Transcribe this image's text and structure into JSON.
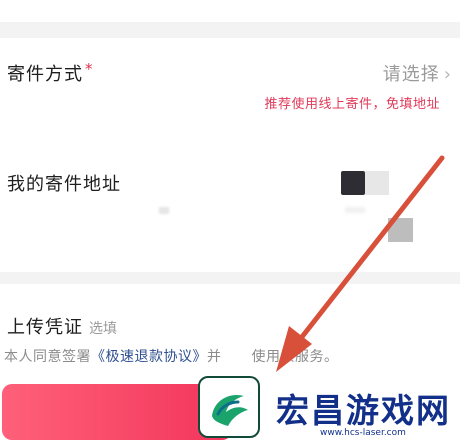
{
  "shipping": {
    "method_label": "寄件方式",
    "required_mark": "*",
    "select_placeholder": "请选择",
    "chevron": "›",
    "tip": "推荐使用线上寄件，免填地址",
    "address_label": "我的寄件地址"
  },
  "upload": {
    "label": "上传凭证",
    "optional": "选填"
  },
  "agreement": {
    "prefix": "本人同意签署",
    "link": "《极速退款协议》",
    "suffix": "并",
    "suffix_hidden": "使用该服务。"
  },
  "watermark": {
    "brand": "宏昌游戏网",
    "url": "www.hcs-laser.com",
    "logo_icon": "dragon-logo-icon"
  },
  "colors": {
    "accent_red": "#e0314b",
    "button_pink": "#f2355b",
    "arrow": "#d8503a",
    "watermark_blue": "#12308a"
  }
}
